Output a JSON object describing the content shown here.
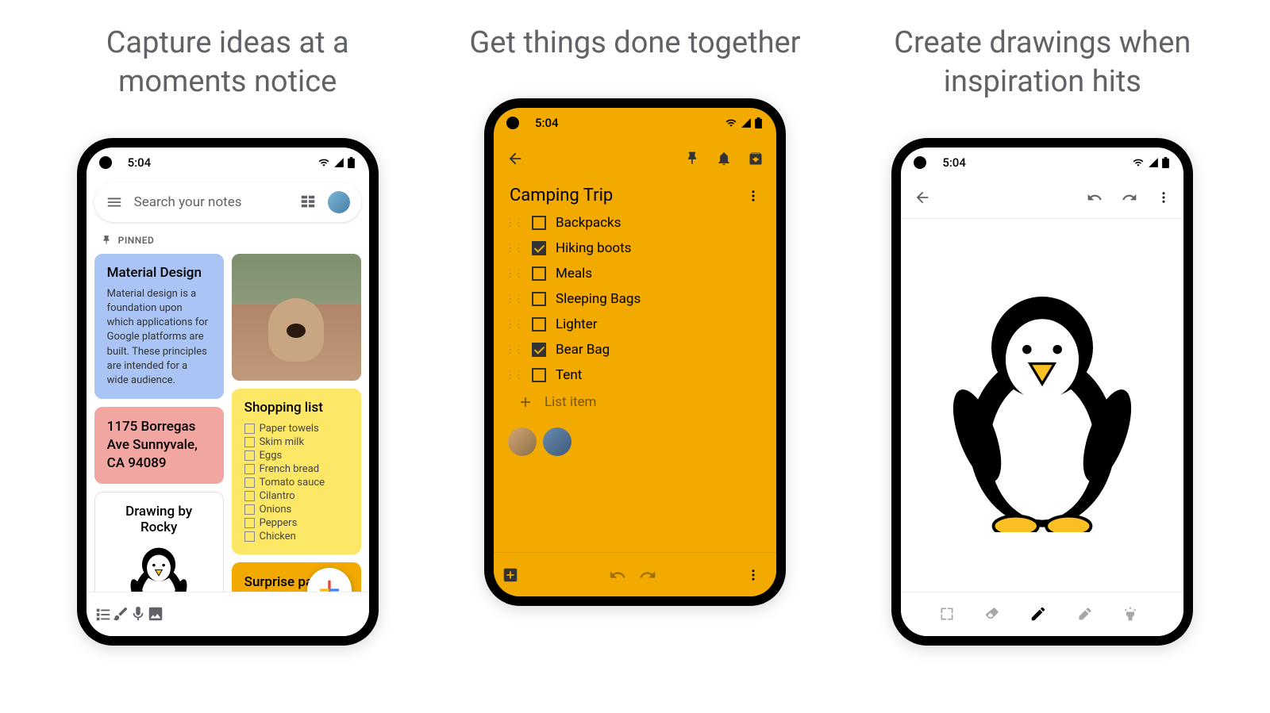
{
  "headlines": {
    "p1": "Capture ideas at a moments notice",
    "p2": "Get things done together",
    "p3": "Create drawings when inspiration hits"
  },
  "status": {
    "time": "5:04"
  },
  "phone1": {
    "search_placeholder": "Search your notes",
    "pinned_label": "PINNED",
    "notes": {
      "material": {
        "title": "Material Design",
        "body": "Material design is a foundation upon which applications for Google platforms are built. These principles are intended for a wide audience."
      },
      "address": "1175 Borregas Ave Sunnyvale, CA 94089",
      "drawing_title": "Drawing by Rocky",
      "shopping": {
        "title": "Shopping list",
        "items": [
          "Paper towels",
          "Skim milk",
          "Eggs",
          "French bread",
          "Tomato sauce",
          "Cilantro",
          "Onions",
          "Peppers",
          "Chicken"
        ]
      },
      "surprise": "Surprise party for Rocky!"
    }
  },
  "phone2": {
    "title": "Camping Trip",
    "items": [
      {
        "label": "Backpacks",
        "checked": false
      },
      {
        "label": "Hiking boots",
        "checked": true
      },
      {
        "label": "Meals",
        "checked": false
      },
      {
        "label": "Sleeping Bags",
        "checked": false
      },
      {
        "label": "Lighter",
        "checked": false
      },
      {
        "label": "Bear Bag",
        "checked": true
      },
      {
        "label": "Tent",
        "checked": false
      }
    ],
    "add_item": "List item"
  }
}
